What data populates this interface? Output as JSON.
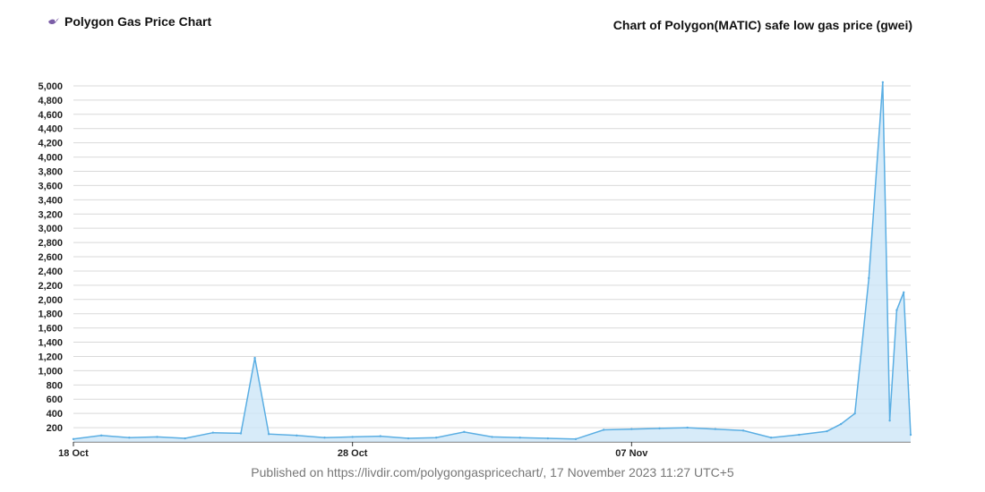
{
  "header": {
    "app_title": "Polygon Gas Price Chart",
    "chart_title": "Chart of Polygon(MATIC) safe low gas price (gwei)",
    "logo_icon": "hummingbird-icon"
  },
  "footer": {
    "published": "Published on https://livdir.com/polygongaspricechart/, 17 November 2023 11:27 UTC+5"
  },
  "chart_data": {
    "type": "area",
    "title": "Chart of Polygon(MATIC) safe low gas price (gwei)",
    "xlabel": "",
    "ylabel": "",
    "ylim": [
      0,
      5100
    ],
    "yticks": [
      200,
      400,
      600,
      800,
      1000,
      1200,
      1400,
      1600,
      1800,
      2000,
      2200,
      2400,
      2600,
      2800,
      3000,
      3200,
      3400,
      3600,
      3800,
      4000,
      4200,
      4400,
      4600,
      4800,
      5000
    ],
    "ytick_labels": [
      "200",
      "400",
      "600",
      "800",
      "1,000",
      "1,200",
      "1,400",
      "1,600",
      "1,800",
      "2,000",
      "2,200",
      "2,400",
      "2,600",
      "2,800",
      "3,000",
      "3,200",
      "3,400",
      "3,600",
      "3,800",
      "4,000",
      "4,200",
      "4,400",
      "4,600",
      "4,800",
      "5,000"
    ],
    "xlim": [
      "2023-10-18",
      "2023-11-17"
    ],
    "xticks": [
      {
        "x": "2023-10-18",
        "label": "18 Oct"
      },
      {
        "x": "2023-10-28",
        "label": "28 Oct"
      },
      {
        "x": "2023-11-07",
        "label": "07 Nov"
      }
    ],
    "grid": true,
    "colors": {
      "line": "#5aaee3",
      "fill": "#cde6f7"
    },
    "x": [
      "2023-10-18",
      "2023-10-19",
      "2023-10-20",
      "2023-10-21",
      "2023-10-22",
      "2023-10-23",
      "2023-10-24",
      "2023-10-24 12:00",
      "2023-10-25",
      "2023-10-26",
      "2023-10-27",
      "2023-10-28",
      "2023-10-29",
      "2023-10-30",
      "2023-10-31",
      "2023-11-01",
      "2023-11-02",
      "2023-11-03",
      "2023-11-04",
      "2023-11-05",
      "2023-11-06",
      "2023-11-07",
      "2023-11-08",
      "2023-11-09",
      "2023-11-10",
      "2023-11-11",
      "2023-11-12",
      "2023-11-13",
      "2023-11-14",
      "2023-11-14 12:00",
      "2023-11-15",
      "2023-11-15 12:00",
      "2023-11-16",
      "2023-11-16 06:00",
      "2023-11-16 12:00",
      "2023-11-16 18:00",
      "2023-11-17"
    ],
    "values": [
      40,
      90,
      60,
      70,
      50,
      130,
      120,
      1180,
      110,
      90,
      60,
      70,
      80,
      50,
      60,
      140,
      70,
      60,
      50,
      40,
      170,
      180,
      190,
      200,
      180,
      160,
      60,
      100,
      150,
      250,
      400,
      2300,
      5050,
      300,
      1850,
      2100,
      100
    ]
  }
}
